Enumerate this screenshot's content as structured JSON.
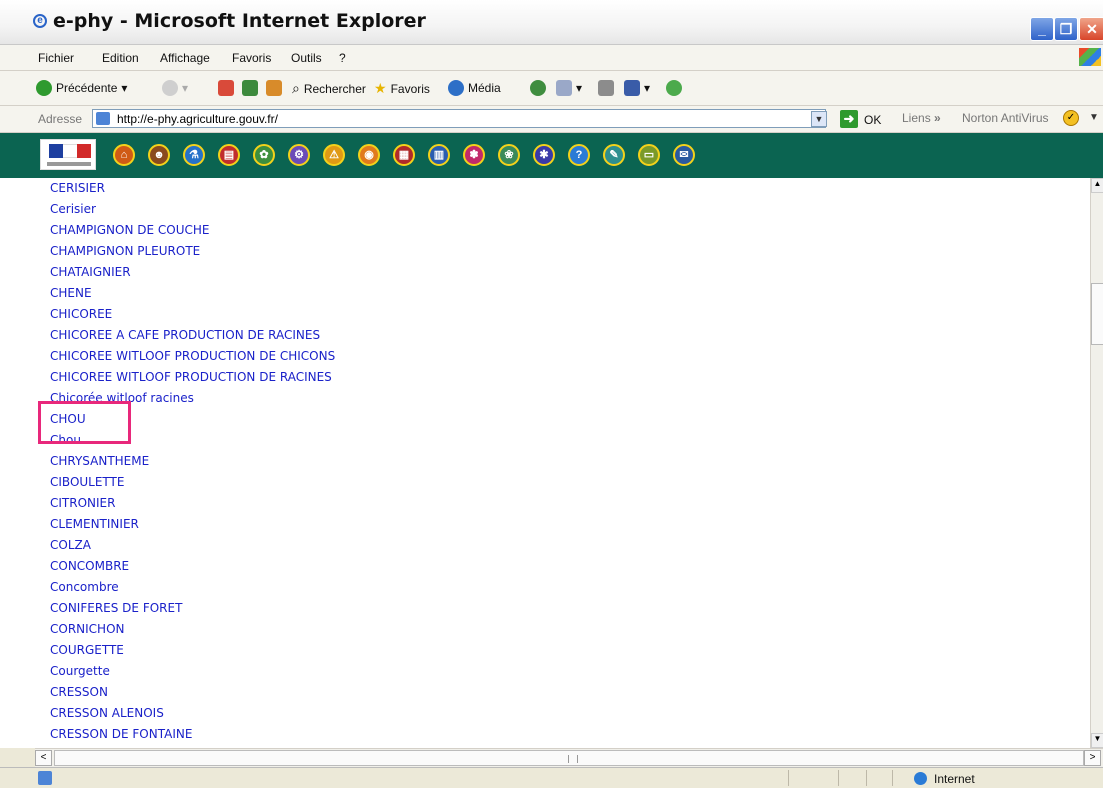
{
  "window": {
    "title": "e-phy - Microsoft Internet Explorer",
    "controls": {
      "minimize": "_",
      "maximize": "❐",
      "close": "✕"
    }
  },
  "menu": [
    "Fichier",
    "Edition",
    "Affichage",
    "Favoris",
    "Outils",
    "?"
  ],
  "toolbar": {
    "back": "Précédente",
    "search": "Rechercher",
    "favorites": "Favoris",
    "media": "Média"
  },
  "address": {
    "label": "Adresse",
    "url": "http://e-phy.agriculture.gouv.fr/",
    "go_label": "OK",
    "links_label": "Liens",
    "links_chevron": "»",
    "norton_label": "Norton AntiVirus"
  },
  "site_nav": {
    "icons": [
      "home-icon",
      "person-icon",
      "flask-icon",
      "document-icon",
      "bug-icon",
      "tractor-icon",
      "warning-icon",
      "pumpkin-icon",
      "calendar-icon",
      "building-icon",
      "flower-icon",
      "insect-icon",
      "sprayer-icon",
      "help-icon",
      "tools-icon",
      "card-icon",
      "book-icon"
    ],
    "glyphs": [
      "⌂",
      "☻",
      "⚗",
      "▤",
      "✿",
      "⚙",
      "⚠",
      "◉",
      "▦",
      "▥",
      "✽",
      "❀",
      "✱",
      "?",
      "✎",
      "▭",
      "✉"
    ]
  },
  "crop_list": [
    "CERISIER",
    "Cerisier",
    "CHAMPIGNON DE COUCHE",
    "CHAMPIGNON PLEUROTE",
    "CHATAIGNIER",
    "CHENE",
    "CHICOREE",
    "CHICOREE A CAFE PRODUCTION DE RACINES",
    "CHICOREE WITLOOF PRODUCTION DE CHICONS",
    "CHICOREE WITLOOF PRODUCTION DE RACINES",
    "Chicorée witloof racines",
    "CHOU",
    "Chou",
    "CHRYSANTHEME",
    "CIBOULETTE",
    "CITRONIER",
    "CLEMENTINIER",
    "COLZA",
    "CONCOMBRE",
    "Concombre",
    "CONIFERES DE FORET",
    "CORNICHON",
    "COURGETTE",
    "Courgette",
    "CRESSON",
    "CRESSON ALENOIS",
    "CRESSON DE FONTAINE"
  ],
  "scroll": {
    "up": "▲",
    "down": "▼",
    "left": "<",
    "right": ">"
  },
  "status": {
    "zone": "Internet"
  },
  "colors": {
    "site_bar": "#0b6451",
    "link": "#1a21c9",
    "highlight": "#e8287b",
    "nav_ring": "#f3d21b"
  }
}
